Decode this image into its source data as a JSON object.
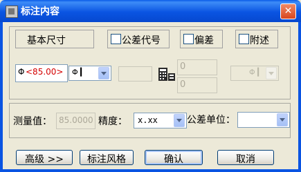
{
  "window": {
    "title": "标注内容",
    "close_glyph": "✕"
  },
  "top_row": {
    "basic_size_label": "基本尺寸",
    "tolerance_code": {
      "label": "公差代号",
      "checked": false
    },
    "deviation": {
      "label": "偏差",
      "checked": false
    },
    "note": {
      "label": "附述",
      "checked": false
    }
  },
  "dim_row": {
    "text_prefix": "Φ",
    "text_value": "<85.00>",
    "symbol_combo": {
      "value": "Φ  ▎"
    },
    "upper_dev": "0",
    "lower_dev": "0",
    "right_combo": {
      "value": "Φ  ▎"
    }
  },
  "measure_row": {
    "measure_label": "测量值：",
    "measure_value": "85.0000",
    "precision_label": "精度：",
    "precision_value": "x.xx",
    "tol_unit_label": "公差单位：",
    "tol_unit_value": ""
  },
  "buttons": {
    "advanced": "高级 >>",
    "style": "标注风格",
    "ok": "确认",
    "cancel": "取消"
  },
  "icons": {
    "app": "app-icon",
    "calc": "calculator-icon"
  }
}
